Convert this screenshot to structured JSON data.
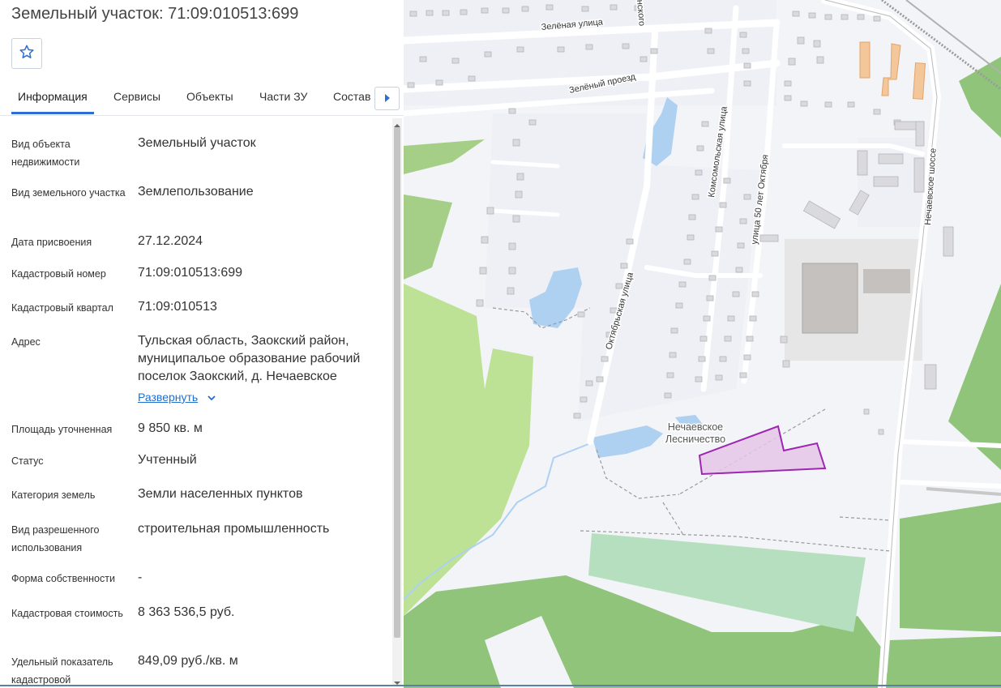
{
  "header": {
    "title": "Земельный участок: 71:09:010513:699"
  },
  "favorite": {
    "icon": "star-icon"
  },
  "tabs": [
    {
      "label": "Информация",
      "active": true
    },
    {
      "label": "Сервисы"
    },
    {
      "label": "Объекты"
    },
    {
      "label": "Части ЗУ"
    },
    {
      "label": "Состав"
    }
  ],
  "tab_next_icon": "chevron-right-icon",
  "info": [
    {
      "label": "Вид объекта недвижимости",
      "value": "Земельный участок"
    },
    {
      "label": "Вид земельного участка",
      "value": "Землепользование"
    },
    {
      "label": "Дата присвоения",
      "value": "27.12.2024"
    },
    {
      "label": "Кадастровый номер",
      "value": "71:09:010513:699"
    },
    {
      "label": "Кадастровый квартал",
      "value": "71:09:010513"
    },
    {
      "label": "Адрес",
      "value": "Тульская область, Заокский район, муниципальое образование рабочий поселок Заокский, д. Нечаевское"
    },
    {
      "label": "Площадь уточненная",
      "value": "9 850 кв. м"
    },
    {
      "label": "Статус",
      "value": "Учтенный"
    },
    {
      "label": "Категория земель",
      "value": "Земли населенных пунктов"
    },
    {
      "label": "Вид разрешенного использования",
      "value": "строительная промышленность"
    },
    {
      "label": "Форма собственности",
      "value": "-"
    },
    {
      "label": "Кадастровая стоимость",
      "value": "8 363 536,5 руб."
    },
    {
      "label": "Удельный показатель кадастровой",
      "value": "849,09 руб./кв. м"
    }
  ],
  "expand_label": "Развернуть",
  "map": {
    "streets": {
      "zelenaya": "Зелёная улица",
      "zeleny_proezd": "Зелёный проезд",
      "oktyabrskaya": "Октябрьская улица",
      "komsomolskaya": "Комсомольская улица",
      "ulitsa50": "улица 50 лет Октября",
      "nechaevskoe_shosse": "Нечаевское шоссе",
      "top_fragment": "нского"
    },
    "place_label_1": "Нечаевское",
    "place_label_2": "Лесничество",
    "parcel_color": "#9c27b0"
  }
}
